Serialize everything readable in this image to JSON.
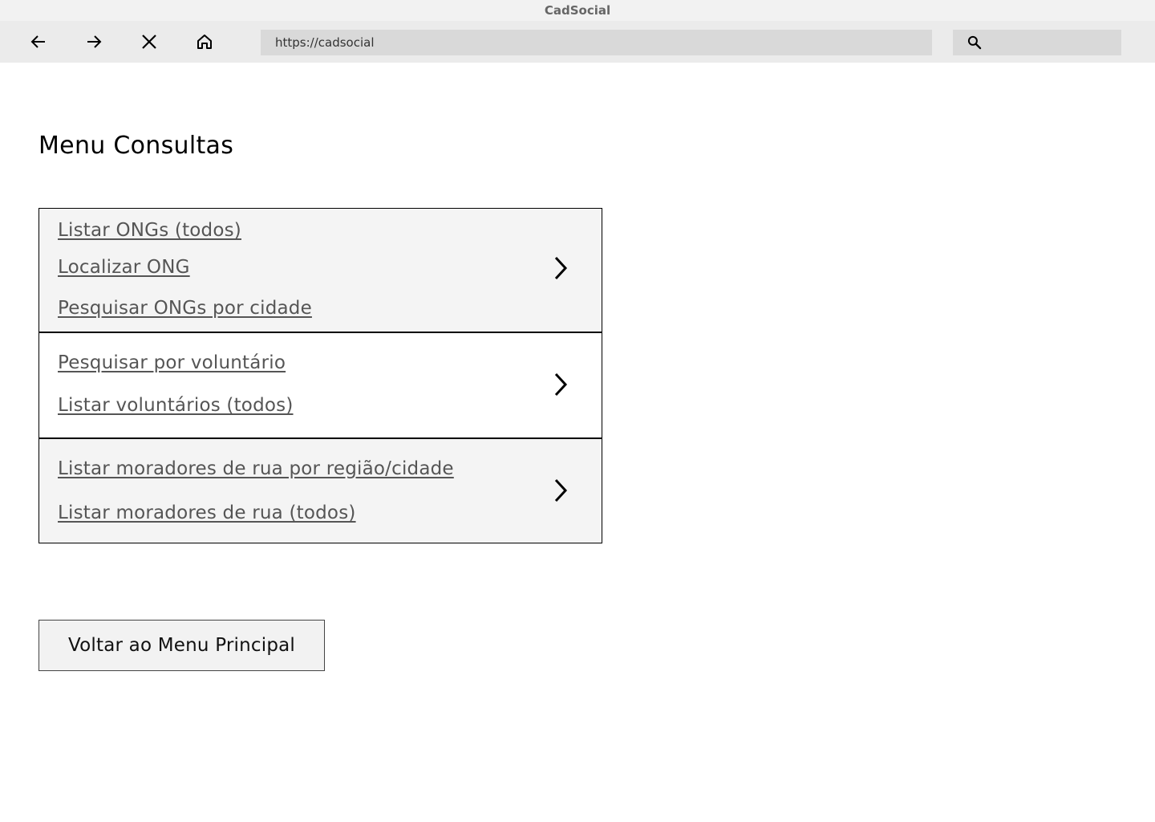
{
  "window": {
    "title": "CadSocial"
  },
  "toolbar": {
    "back_icon": "arrow-left-icon",
    "forward_icon": "arrow-right-icon",
    "stop_icon": "close-icon",
    "home_icon": "home-icon",
    "url": "https://cadsocial",
    "search_icon": "search-icon"
  },
  "main": {
    "title": "Menu Consultas",
    "sections": [
      {
        "links": [
          "Listar ONGs (todos)",
          "Localizar ONG",
          "Pesquisar ONGs por cidade"
        ],
        "chevron_icon": "chevron-right-icon"
      },
      {
        "links": [
          "Pesquisar por voluntário",
          "Listar voluntários (todos)"
        ],
        "chevron_icon": "chevron-right-icon"
      },
      {
        "links": [
          "Listar moradores de rua por região/cidade",
          "Listar moradores de rua (todos)"
        ],
        "chevron_icon": "chevron-right-icon"
      }
    ],
    "back_button_label": "Voltar ao Menu Principal"
  },
  "colors": {
    "titlebar_bg": "#f2f2f2",
    "toolbar_bg": "#ebebeb",
    "field_bg": "#d9d9d9",
    "section_shaded_bg": "#f4f4f4",
    "link_text": "#555555",
    "border": "#000000"
  }
}
